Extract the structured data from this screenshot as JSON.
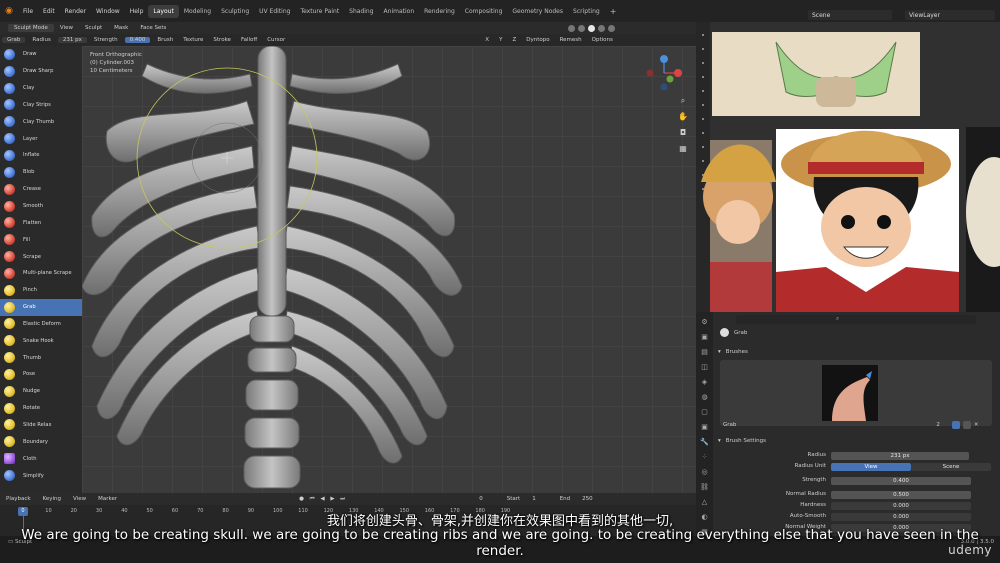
{
  "topbar": {
    "menus": [
      "File",
      "Edit",
      "Render",
      "Window",
      "Help"
    ],
    "workspaces": [
      "Layout",
      "Modeling",
      "Sculpting",
      "UV Editing",
      "Texture Paint",
      "Shading",
      "Animation",
      "Rendering",
      "Compositing",
      "Geometry Nodes",
      "Scripting"
    ],
    "active_workspace": "Layout",
    "scene": "Scene",
    "view_layer": "ViewLayer"
  },
  "header": {
    "mode": "Sculpt Mode",
    "menus": [
      "View",
      "Sculpt",
      "Mask",
      "Face Sets"
    ]
  },
  "tool_settings": {
    "brush": "Grab",
    "radius_label": "Radius",
    "radius": "231 px",
    "strength_label": "Strength",
    "strength": "0.400",
    "menus": [
      "Brush",
      "Texture",
      "Stroke",
      "Falloff",
      "Cursor"
    ],
    "axis": [
      "X",
      "Y",
      "Z"
    ],
    "right_menus": [
      "Dyntopo",
      "Remesh",
      "Options"
    ]
  },
  "tools": [
    {
      "label": "Draw",
      "color": "blue"
    },
    {
      "label": "Draw Sharp",
      "color": "blue"
    },
    {
      "label": "Clay",
      "color": "blue"
    },
    {
      "label": "Clay Strips",
      "color": "blue"
    },
    {
      "label": "Clay Thumb",
      "color": "blue"
    },
    {
      "label": "Layer",
      "color": "blue"
    },
    {
      "label": "Inflate",
      "color": "blue"
    },
    {
      "label": "Blob",
      "color": "blue"
    },
    {
      "label": "Crease",
      "color": "red"
    },
    {
      "label": "Smooth",
      "color": "red"
    },
    {
      "label": "Flatten",
      "color": "red"
    },
    {
      "label": "Fill",
      "color": "red"
    },
    {
      "label": "Scrape",
      "color": "red"
    },
    {
      "label": "Multi-plane Scrape",
      "color": "red"
    },
    {
      "label": "Pinch",
      "color": "yel"
    },
    {
      "label": "Grab",
      "color": "yel",
      "active": true
    },
    {
      "label": "Elastic Deform",
      "color": "yel"
    },
    {
      "label": "Snake Hook",
      "color": "yel"
    },
    {
      "label": "Thumb",
      "color": "yel"
    },
    {
      "label": "Pose",
      "color": "yel"
    },
    {
      "label": "Nudge",
      "color": "yel"
    },
    {
      "label": "Rotate",
      "color": "yel"
    },
    {
      "label": "Slide Relax",
      "color": "yel"
    },
    {
      "label": "Boundary",
      "color": "yel"
    },
    {
      "label": "Cloth",
      "color": "pur"
    },
    {
      "label": "Simplify",
      "color": "blue"
    }
  ],
  "viewport": {
    "line1": "Front Orthographic",
    "line2": "(0) Cylinder.003",
    "line3": "10 Centimeters"
  },
  "properties": {
    "active_tool": "Grab",
    "brushes_panel": "Brushes",
    "brush_name": "Grab",
    "brush_users": "2",
    "brush_settings_panel": "Brush Settings",
    "radius_label": "Radius",
    "radius": "231 px",
    "radius_unit_label": "Radius Unit",
    "unit_view": "View",
    "unit_scene": "Scene",
    "strength_label": "Strength",
    "strength": "0.400",
    "normal_radius_label": "Normal Radius",
    "normal_radius": "0.500",
    "hardness_label": "Hardness",
    "hardness": "0.000",
    "autosmooth_label": "Auto-Smooth",
    "autosmooth": "0.000",
    "normal_weight_label": "Normal Weight",
    "normal_weight": "0.000"
  },
  "timeline": {
    "menus": [
      "Playback",
      "Keying",
      "View",
      "Marker"
    ],
    "current_frame": "0",
    "start_label": "Start",
    "start": "1",
    "end_label": "End",
    "end": "250",
    "ruler": [
      "0",
      "10",
      "20",
      "30",
      "40",
      "50",
      "60",
      "70",
      "80",
      "90",
      "100",
      "110",
      "120",
      "130",
      "140",
      "150",
      "160",
      "170",
      "180",
      "190",
      "200",
      "210",
      "220",
      "230",
      "240",
      "250"
    ]
  },
  "status": {
    "mode": "Sculpt",
    "version": "3.0.0 | 3.5.0"
  },
  "subtitles": {
    "cn": "我们将创建头骨、骨架,并创建你在效果图中看到的其他一切,",
    "en": "We are going to be creating skull. we are going to be creating ribs and we are going. to be creating everything else that you have seen in the render."
  },
  "brand": "udemy",
  "colors": {
    "accent": "#4772b3",
    "viewport_bg": "#3b3b3b",
    "brush_circle": "#c8c85a"
  }
}
